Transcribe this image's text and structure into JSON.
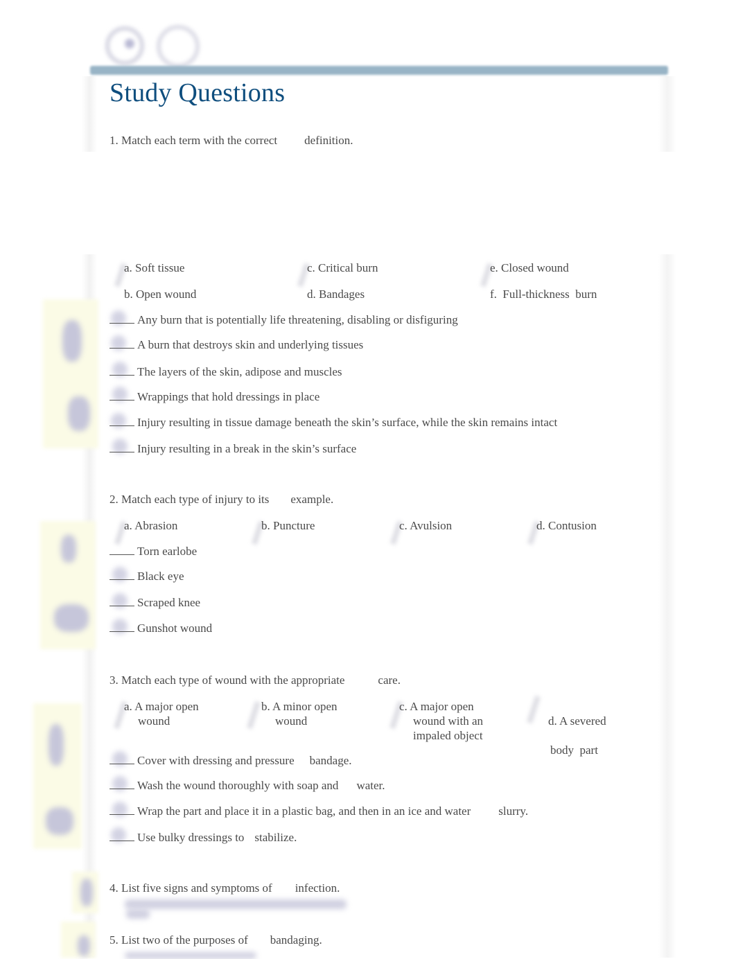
{
  "page_title": "Study Questions",
  "brand_color": "#0f4e7e",
  "header_bar_color": "#98b4c6",
  "questions": {
    "q1": {
      "prompt_a": "1. Match each term with the correct",
      "prompt_b": "definition.",
      "options": [
        {
          "letter": "a.",
          "text": "Soft tissue"
        },
        {
          "letter": "b.",
          "text": "Open wound"
        },
        {
          "letter": "c.",
          "text": "Critical burn"
        },
        {
          "letter": "d.",
          "text": "Bandages"
        },
        {
          "letter": "e.",
          "text": "Closed wound"
        },
        {
          "letter": "f.",
          "text": "Full-thickness  burn"
        }
      ],
      "items": [
        "Any burn that is potentially life threatening, disabling or disfiguring",
        "A burn that destroys skin and underlying tissues",
        "The layers of the skin, adipose and muscles",
        "Wrappings that hold dressings in place",
        "Injury resulting in tissue damage beneath the skin’s surface, while the skin remains intact",
        "Injury resulting in a break in the skin’s surface"
      ]
    },
    "q2": {
      "prompt_a": "2. Match each type of injury to its",
      "prompt_b": "example.",
      "options": [
        {
          "letter": "a.",
          "text": "Abrasion"
        },
        {
          "letter": "b.",
          "text": "Puncture"
        },
        {
          "letter": "c.",
          "text": "Avulsion"
        },
        {
          "letter": "d.",
          "text": "Contusion"
        }
      ],
      "items": [
        "Torn earlobe",
        "Black eye",
        "Scraped knee",
        "Gunshot wound"
      ]
    },
    "q3": {
      "prompt_a": "3. Match each type of wound with the appropriate",
      "prompt_b": "care.",
      "options": [
        {
          "line1": "a. A major open",
          "line2": "wound",
          "line3": ""
        },
        {
          "line1": "b. A minor open",
          "line2": "wound",
          "line3": ""
        },
        {
          "line1": "c. A major open",
          "line2": "wound with an",
          "line3": "impaled object"
        },
        {
          "line1": "d. A severed",
          "line2": "body  part",
          "line3": ""
        }
      ],
      "items": [
        {
          "a": "Cover with dressing and pressure",
          "b": "bandage."
        },
        {
          "a": "Wash the wound thoroughly with soap and",
          "b": "water."
        },
        {
          "a": "Wrap the part and place it in a plastic bag, and then in an ice and water",
          "b": "slurry."
        },
        {
          "a": "Use bulky dressings to",
          "b": "stabilize."
        }
      ]
    },
    "q4": {
      "prompt_a": "4. List five signs and symptoms of",
      "prompt_b": "infection."
    },
    "q5": {
      "prompt_a": "5. List two of the purposes of",
      "prompt_b": "bandaging."
    }
  }
}
